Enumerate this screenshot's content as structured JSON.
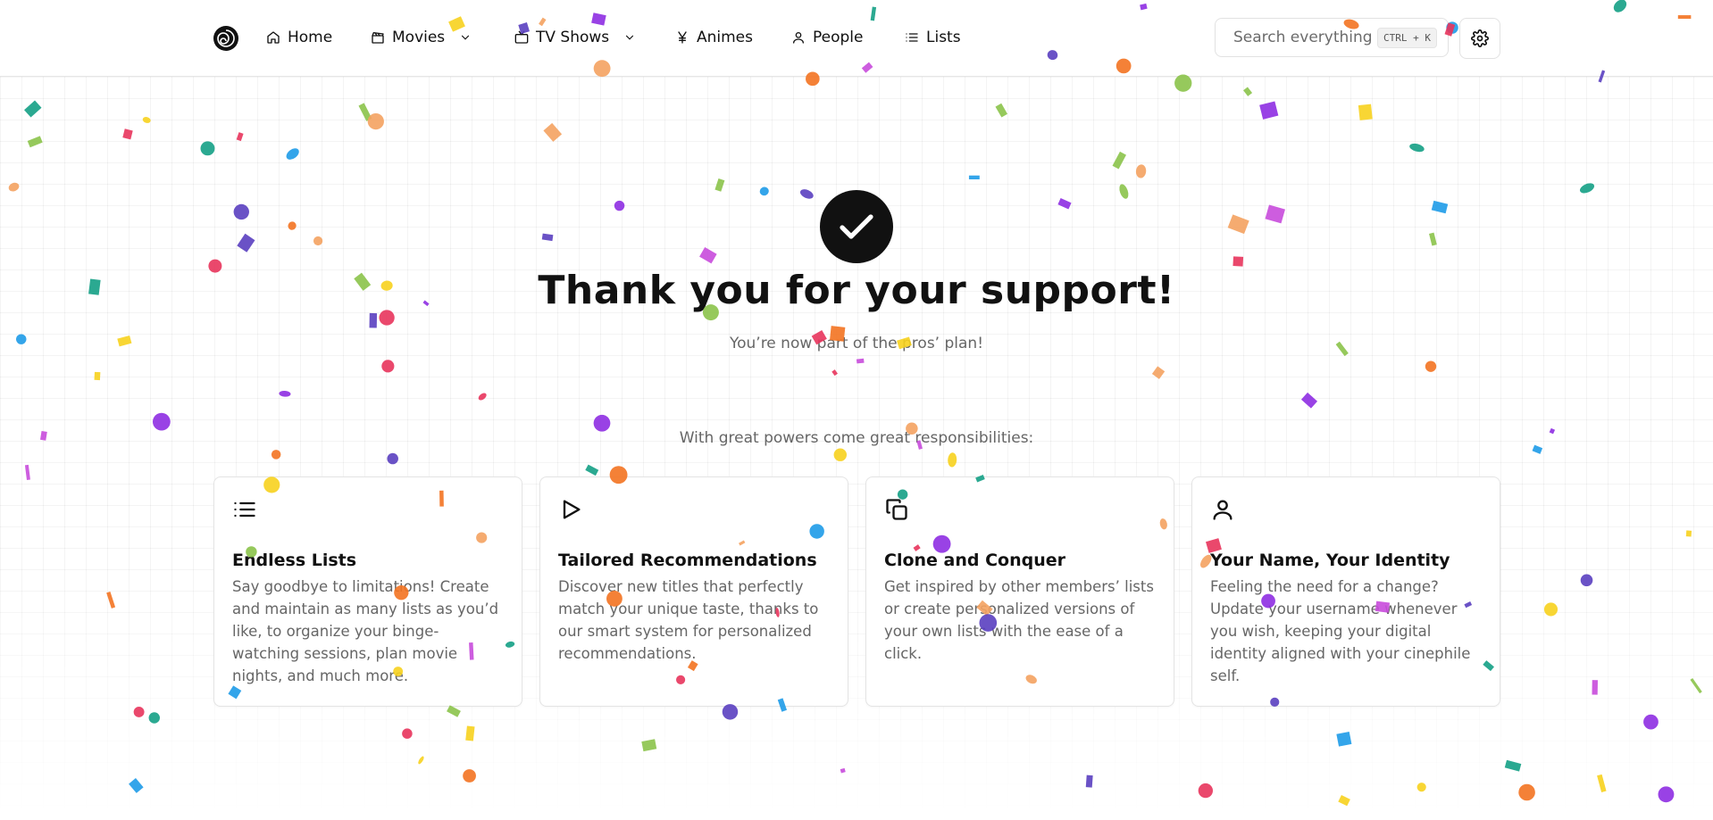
{
  "nav": {
    "items": [
      {
        "label": "Home",
        "icon": "home-icon"
      },
      {
        "label": "Movies",
        "icon": "clapperboard-icon",
        "dropdown": true
      },
      {
        "label": "TV Shows",
        "icon": "tv-icon",
        "dropdown": true
      },
      {
        "label": "Animes",
        "icon": "yen-icon"
      },
      {
        "label": "People",
        "icon": "user-icon"
      },
      {
        "label": "Lists",
        "icon": "list-icon"
      }
    ],
    "search": {
      "placeholder": "Search everything",
      "shortcut": "CTRL + K"
    },
    "settings_icon": "gear-icon"
  },
  "hero": {
    "title": "Thank you for your support!",
    "subtitle": "You’re now part of the pros’ plan!",
    "tagline": "With great powers come great responsibilities:"
  },
  "features": [
    {
      "icon": "list-icon",
      "title": "Endless Lists",
      "description": "Say goodbye to limitations! Create and maintain as many lists as you’d like, to organize your binge-watching sessions, plan movie nights, and much more."
    },
    {
      "icon": "play-icon",
      "title": "Tailored Recommendations",
      "description": "Discover new titles that perfectly match your unique taste, thanks to our smart system for personalized recommendations."
    },
    {
      "icon": "copy-icon",
      "title": "Clone and Conquer",
      "description": "Get inspired by other members’ lists or create personalized versions of your own lists with the ease of a click."
    },
    {
      "icon": "user-icon",
      "title": "Your Name, Your Identity",
      "description": "Feeling the need for a change? Update your username whenever you wish, keeping your digital identity aligned with your cinephile self."
    }
  ],
  "colors": {
    "confetti": [
      "#e8345c",
      "#f7d21e",
      "#8e2de2",
      "#14a085",
      "#f37321",
      "#1e9be8",
      "#5a3fc0",
      "#8bc34a",
      "#c84bdb",
      "#f4a261"
    ]
  }
}
